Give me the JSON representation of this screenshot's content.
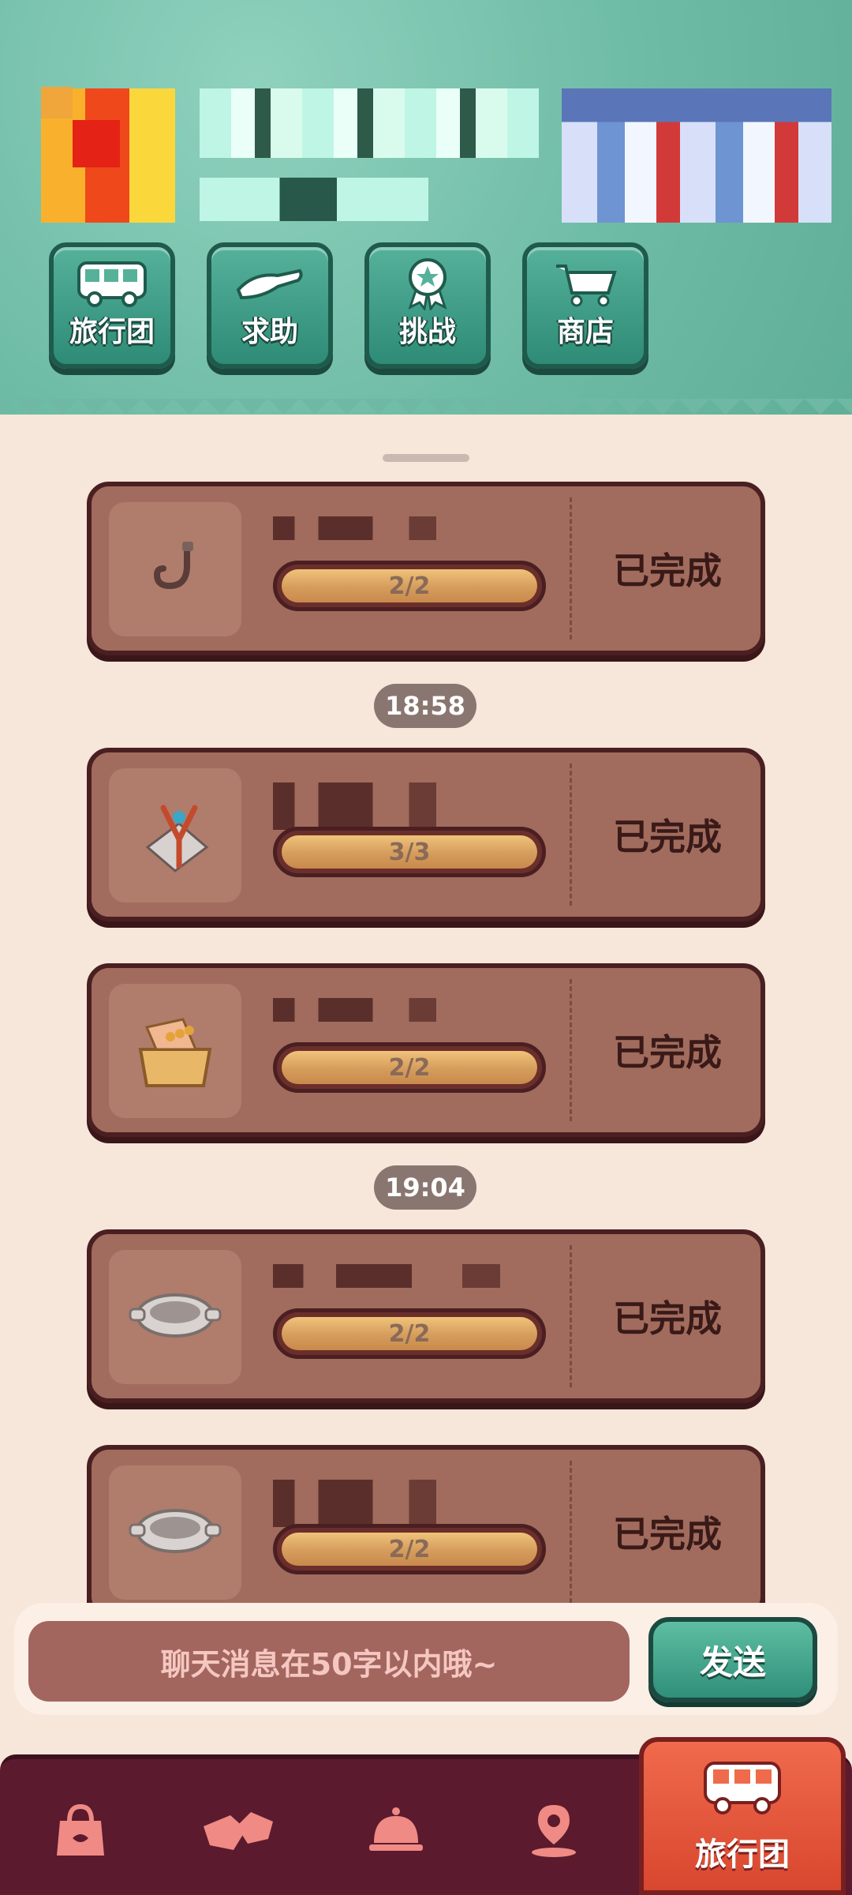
{
  "header": {
    "buttons": [
      {
        "label": "旅行团",
        "icon": "bus-icon"
      },
      {
        "label": "求助",
        "icon": "helping-hand-icon"
      },
      {
        "label": "挑战",
        "icon": "medal-icon"
      },
      {
        "label": "商店",
        "icon": "shopping-cart-icon"
      }
    ]
  },
  "tasks": [
    {
      "item_icon": "hook-icon",
      "progress": "2/2",
      "progress_fraction": 1.0,
      "status": "已完成"
    },
    {
      "item_icon": "slingshot-icon",
      "progress": "3/3",
      "progress_fraction": 1.0,
      "status": "已完成"
    },
    {
      "item_icon": "basket-icon",
      "progress": "2/2",
      "progress_fraction": 1.0,
      "status": "已完成"
    },
    {
      "item_icon": "stone-pot-icon",
      "progress": "2/2",
      "progress_fraction": 1.0,
      "status": "已完成"
    },
    {
      "item_icon": "stone-pot-icon",
      "progress": "2/2",
      "progress_fraction": 1.0,
      "status": "已完成"
    }
  ],
  "timestamps": [
    "18:58",
    "19:04"
  ],
  "chat": {
    "placeholder": "聊天消息在50字以内哦~",
    "send_label": "发送"
  },
  "bottom_nav": {
    "items": [
      {
        "icon": "bag-icon"
      },
      {
        "icon": "handshake-icon"
      },
      {
        "icon": "service-bell-icon"
      },
      {
        "icon": "map-pin-icon"
      }
    ],
    "active": {
      "icon": "bus-icon",
      "label": "旅行团"
    }
  },
  "colors": {
    "header_teal": "#6fbca6",
    "card_brown": "#a16c5d",
    "nav_maroon": "#5b1a2d",
    "active_orange": "#f06a4c"
  }
}
